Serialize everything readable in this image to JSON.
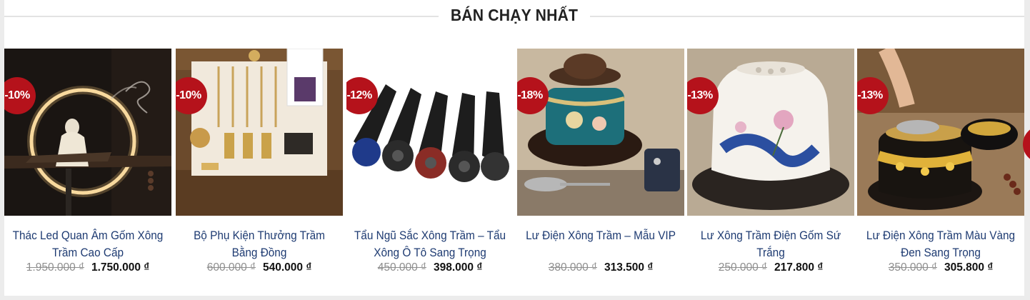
{
  "section": {
    "title": "BÁN CHẠY NHẤT"
  },
  "products": [
    {
      "name": "Thác Led Quan Âm Gốm Xông Trầm Cao Cấp",
      "old_price": "1.950.000 ₫",
      "price": "1.750.000 ₫",
      "discount": "-10%"
    },
    {
      "name": "Bộ Phụ Kiện Thưởng Trầm Bằng Đồng",
      "old_price": "600.000 ₫",
      "price": "540.000 ₫",
      "discount": "-10%"
    },
    {
      "name": "Tẩu Ngũ Sắc Xông Trầm – Tẩu Xông Ô Tô Sang Trọng",
      "old_price": "450.000 ₫",
      "price": "398.000 ₫",
      "discount": "-12%"
    },
    {
      "name": "Lư Điện Xông Trầm – Mẫu VIP",
      "old_price": "380.000 ₫",
      "price": "313.500 ₫",
      "discount": "-18%"
    },
    {
      "name": "Lư Xông Trầm Điện Gốm Sứ Trắng",
      "old_price": "250.000 ₫",
      "price": "217.800 ₫",
      "discount": "-13%"
    },
    {
      "name": "Lư Điện Xông Trầm Màu Vàng Đen Sang Trọng",
      "old_price": "350.000 ₫",
      "price": "305.800 ₫",
      "discount": "-13%"
    }
  ],
  "colors": {
    "badge": "#b5121b",
    "product_name": "#1e3b72",
    "old_price": "#8e8e8e"
  },
  "icons": [
    "product-image-quan-am-led",
    "product-image-brass-tools",
    "product-image-car-pipes",
    "product-image-electric-burner-vip",
    "product-image-porcelain-burner",
    "product-image-gold-black-burner"
  ]
}
